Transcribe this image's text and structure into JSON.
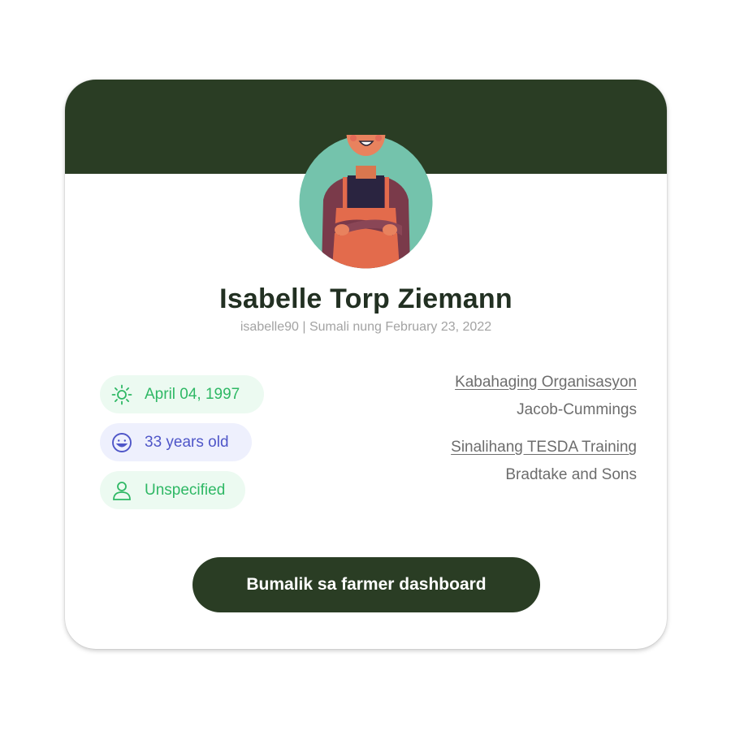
{
  "profile": {
    "name": "Isabelle Torp Ziemann",
    "username": "isabelle90",
    "joined": "Sumali nung February 23, 2022",
    "separator": " | ",
    "avatar_icon": "farmer-avatar-icon"
  },
  "details": {
    "birthdate": "April 04, 1997",
    "age": "33 years old",
    "gender": "Unspecified"
  },
  "info": {
    "org_label": "Kabahaging Organisasyon",
    "org_value": "Jacob-Cummings",
    "tesda_label": "Sinalihang TESDA Training",
    "tesda_value": "Bradtake and Sons"
  },
  "actions": {
    "back_label": "Bumalik sa farmer dashboard"
  },
  "colors": {
    "header": "#2a3d24",
    "button": "#2a3d24",
    "green_pill_bg": "#ecfaf1",
    "green_pill_text": "#2fb865",
    "blue_pill_bg": "#eef0fd",
    "blue_pill_text": "#4f56c8"
  },
  "icons": {
    "birthdate": "sun-icon",
    "age": "smiley-icon",
    "gender": "user-icon"
  }
}
